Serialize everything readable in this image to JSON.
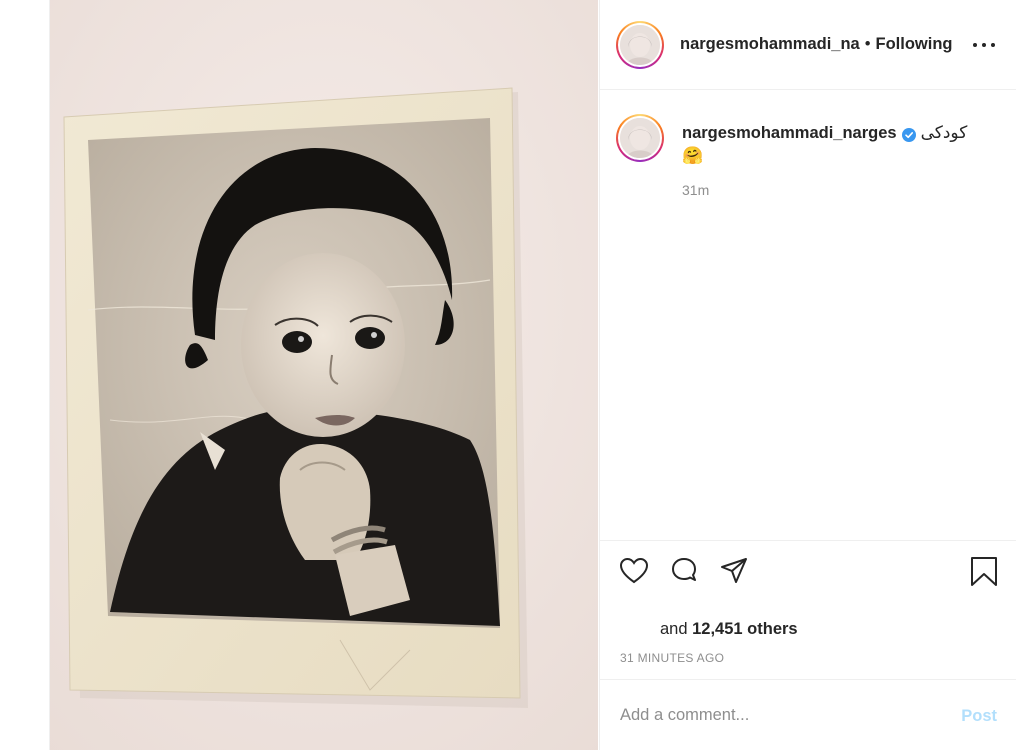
{
  "post": {
    "author": "nargesmohammadi_na",
    "separator": "•",
    "follow_status": "Following",
    "photo_alt": "Vintage black-and-white childhood portrait"
  },
  "caption": {
    "username": "nargesmohammadi_narges",
    "text": "کودکی",
    "emoji": "🤗",
    "time": "31m"
  },
  "engagement": {
    "likes_prefix": "and",
    "likes_count": "12,451 others",
    "posted_time": "31 MINUTES AGO"
  },
  "comment": {
    "placeholder": "Add a comment...",
    "post_label": "Post"
  },
  "colors": {
    "verified": "#3897f0",
    "post_disabled": "#b2dffc",
    "muted": "#8e8e8e"
  },
  "icons": [
    "heart-icon",
    "comment-icon",
    "share-icon",
    "bookmark-icon",
    "more-icon",
    "verified-icon"
  ]
}
